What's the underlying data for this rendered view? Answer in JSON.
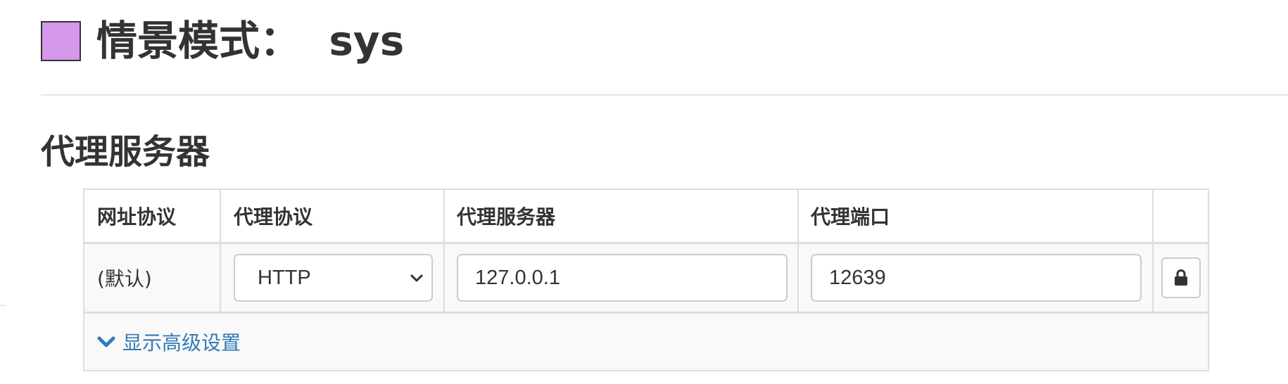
{
  "profile": {
    "title": "情景模式：  sys",
    "color": "#d597e9"
  },
  "section": {
    "title": "代理服务器"
  },
  "table": {
    "headers": {
      "url_protocol": "网址协议",
      "proxy_protocol": "代理协议",
      "proxy_server": "代理服务器",
      "proxy_port": "代理端口",
      "actions": ""
    },
    "row": {
      "url_protocol": "(默认)",
      "proxy_protocol": "HTTP",
      "proxy_server": "127.0.0.1",
      "proxy_port": "12639",
      "action_icon": "lock-icon"
    },
    "advanced_label": "显示高级设置",
    "advanced_icon": "chevron-down-icon"
  },
  "colors": {
    "link": "#337ab7",
    "border": "#dddddd",
    "text": "#333333"
  }
}
